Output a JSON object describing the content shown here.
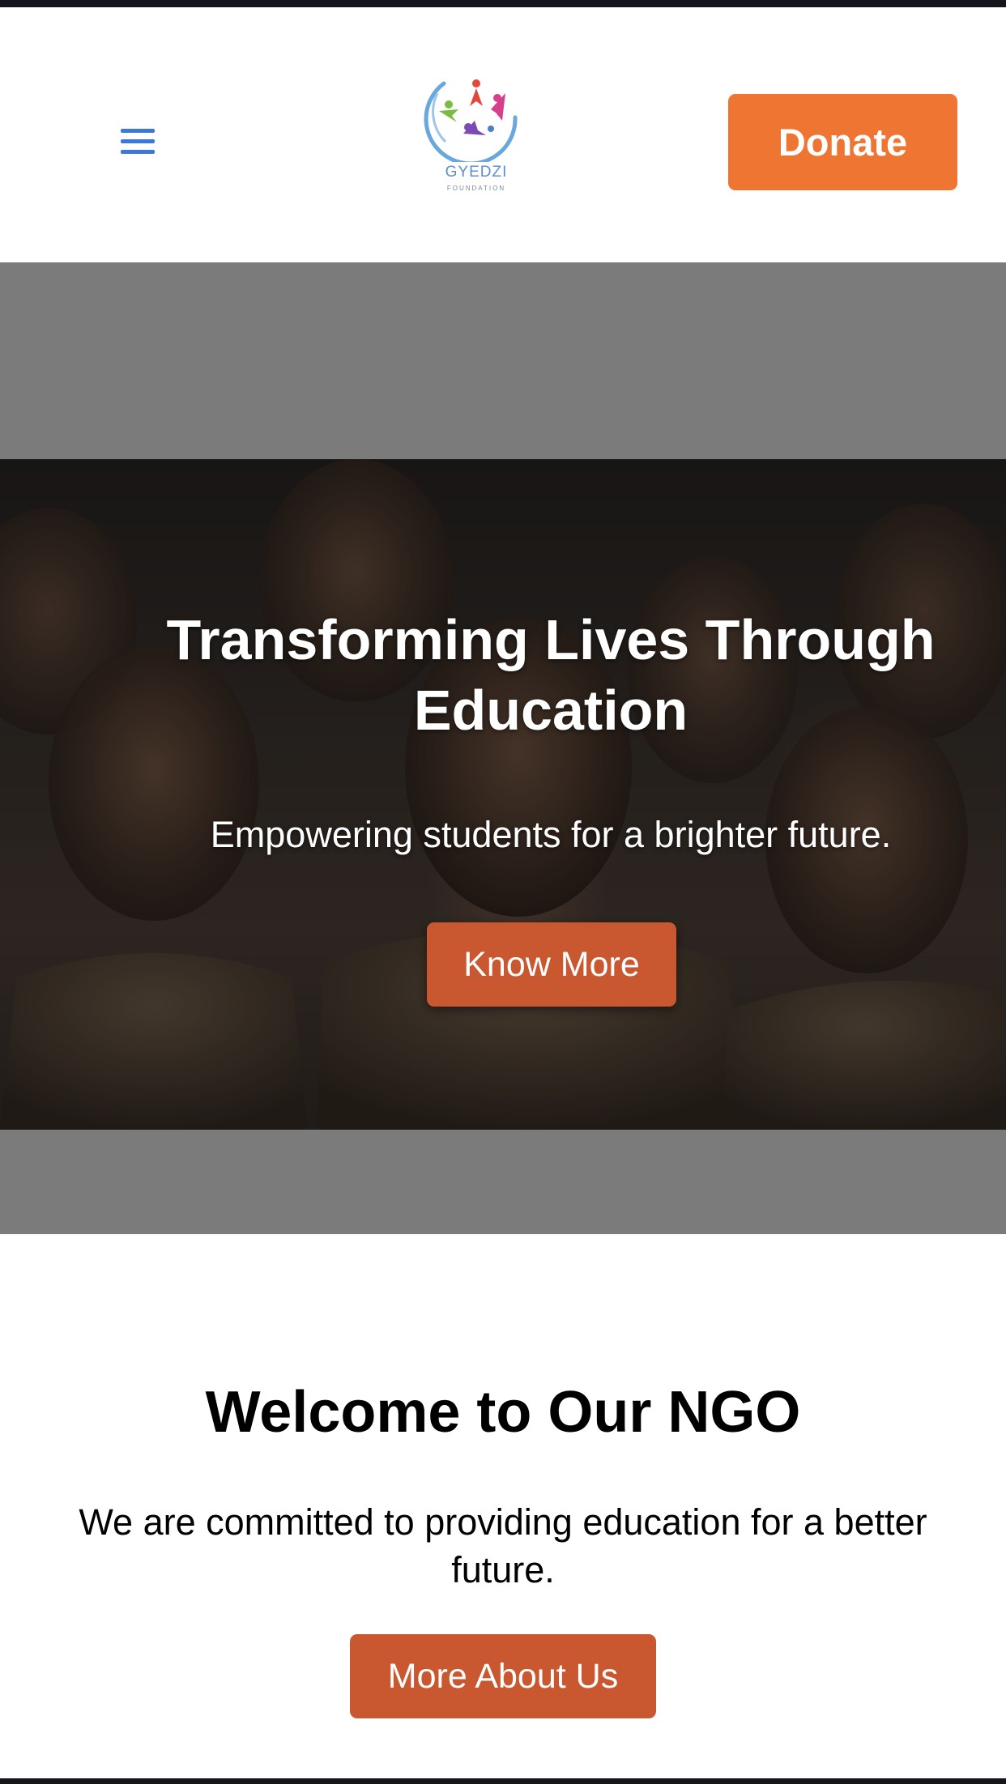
{
  "header": {
    "logo": {
      "name": "GYEDZI",
      "subtitle": "FOUNDATION"
    },
    "donate_label": "Donate"
  },
  "hero": {
    "title": "Transforming Lives Through Education",
    "subtitle": "Empowering students for a brighter future.",
    "cta_label": "Know More"
  },
  "welcome": {
    "title": "Welcome to Our NGO",
    "text": "We are committed to providing education for a better future.",
    "cta_label": "More About Us"
  },
  "colors": {
    "accent_orange": "#ee7532",
    "button_rust": "#c95830",
    "menu_blue": "#3b78d8",
    "hero_backdrop": "#7b7b7b"
  },
  "icons": {
    "menu": "hamburger-icon"
  }
}
